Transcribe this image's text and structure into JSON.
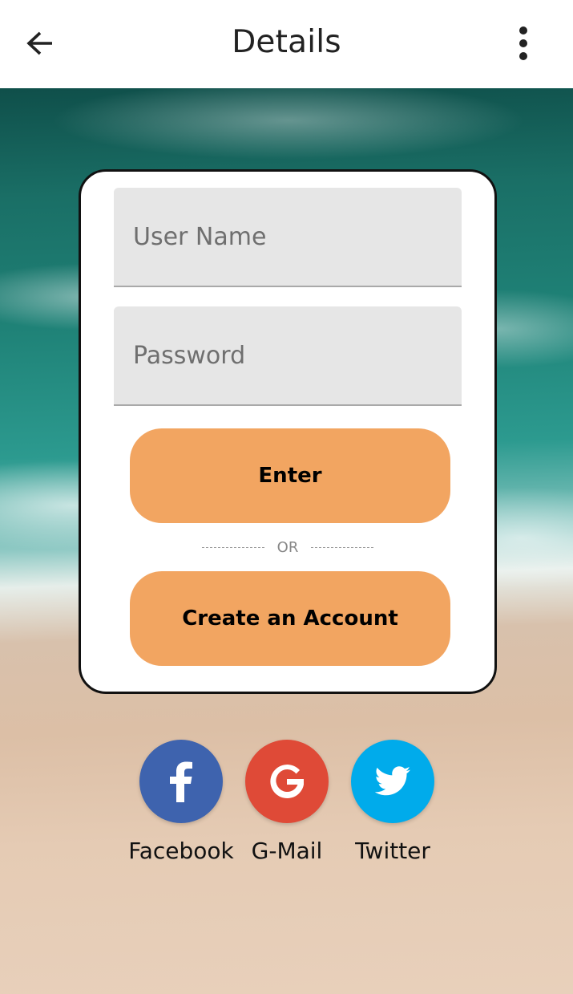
{
  "appbar": {
    "title": "Details",
    "back_icon": "arrow-left-icon",
    "menu_icon": "more-vertical-icon"
  },
  "form": {
    "username_placeholder": "User Name",
    "password_placeholder": "Password",
    "enter_label": "Enter",
    "divider_text": "OR",
    "create_label": "Create an Account"
  },
  "social": [
    {
      "label": "Facebook",
      "icon": "facebook-icon",
      "color": "#3e63ae"
    },
    {
      "label": "G-Mail",
      "icon": "google-icon",
      "color": "#df4a37"
    },
    {
      "label": "Twitter",
      "icon": "twitter-icon",
      "color": "#00abeb"
    }
  ],
  "colors": {
    "button_accent": "#f2a561",
    "field_background": "#e6e6e6"
  }
}
